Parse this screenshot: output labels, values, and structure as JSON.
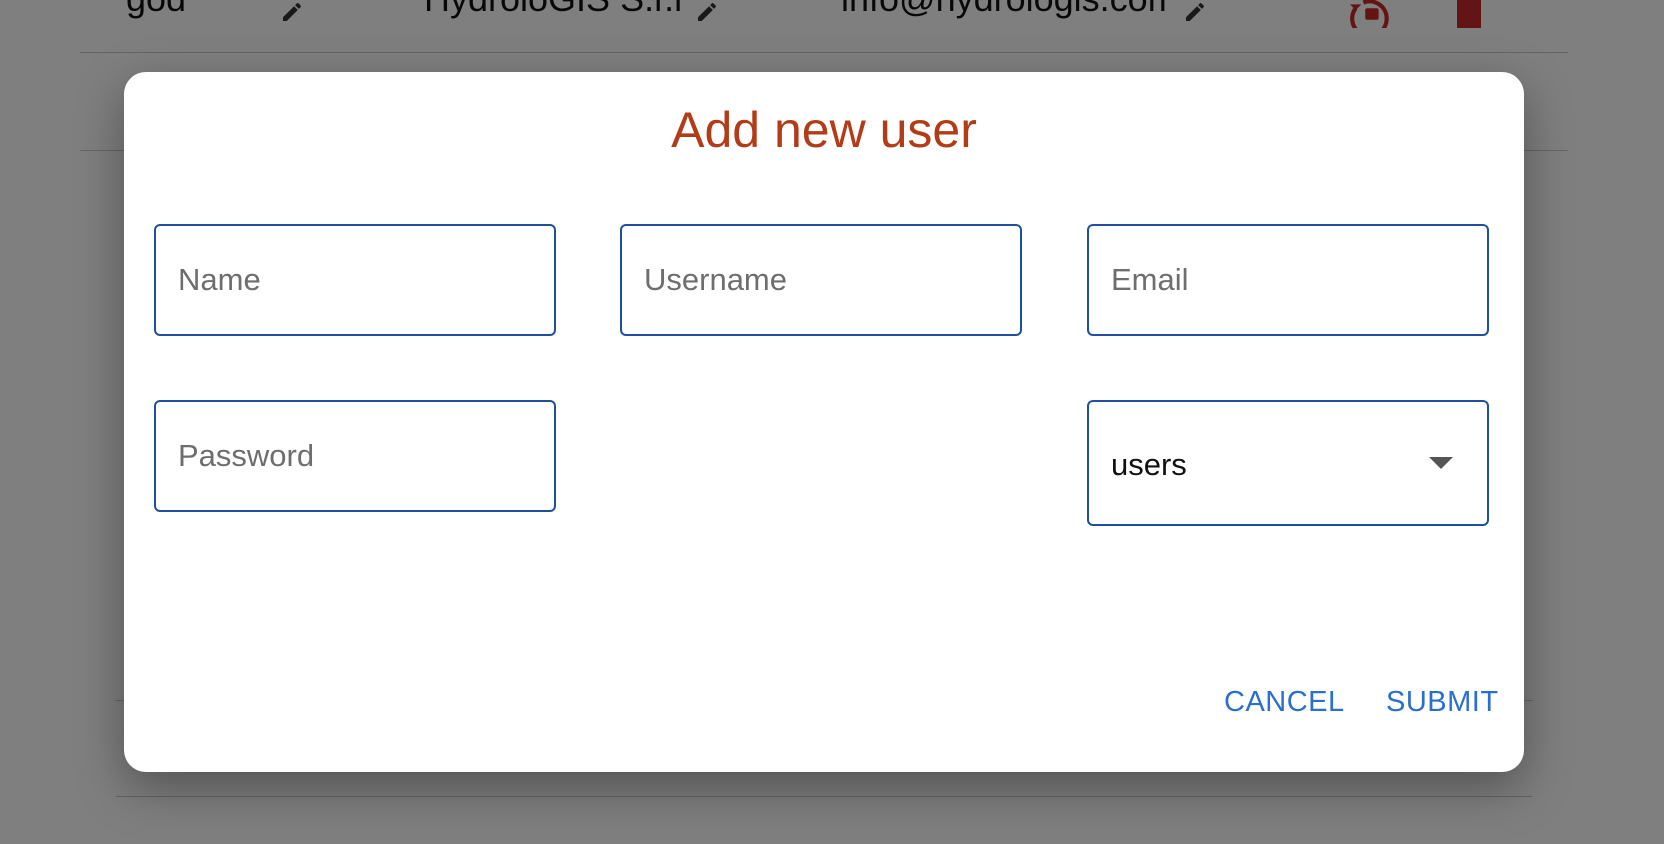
{
  "background_table": {
    "row1": {
      "username": "god",
      "company": "HydroloGIS S.r.l.",
      "email": "info@hydrologis.com"
    }
  },
  "dialog": {
    "title": "Add new user",
    "fields": {
      "name": {
        "placeholder": "Name",
        "value": ""
      },
      "username": {
        "placeholder": "Username",
        "value": ""
      },
      "email": {
        "placeholder": "Email",
        "value": ""
      },
      "password": {
        "placeholder": "Password",
        "value": ""
      }
    },
    "role_select": {
      "selected": "users"
    },
    "buttons": {
      "cancel": "CANCEL",
      "submit": "SUBMIT"
    }
  },
  "colors": {
    "title": "#b23c17",
    "field_border": "#1e4fa0",
    "button_text": "#2a6fcf",
    "action_icon_red": "#c62828"
  },
  "icons": [
    "pencil-icon",
    "lock-reset-icon",
    "trash-icon",
    "dropdown-caret-icon"
  ]
}
